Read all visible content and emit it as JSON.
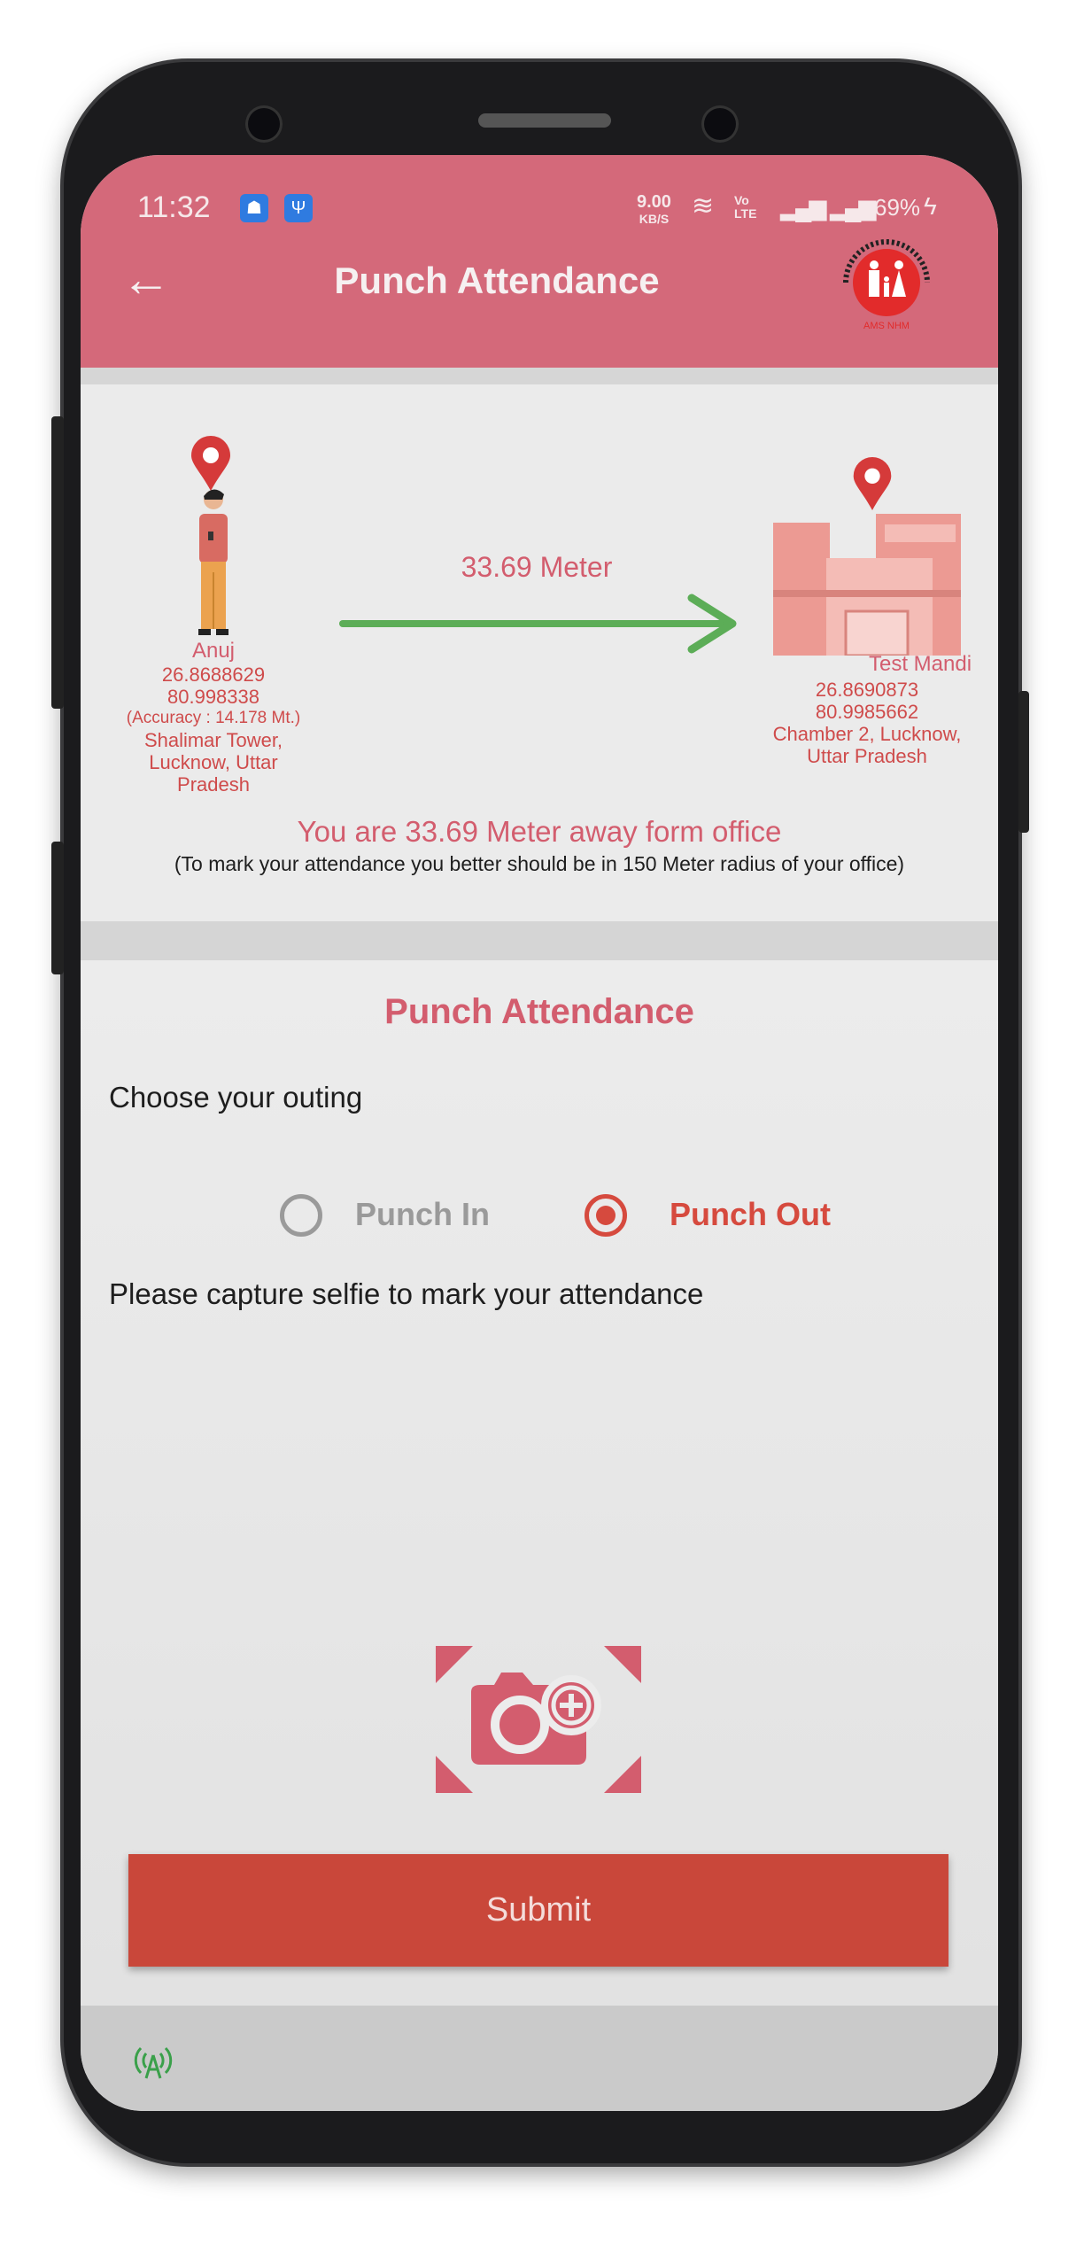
{
  "status_bar": {
    "time": "11:32",
    "net_speed": "9.00",
    "net_unit": "KB/S",
    "volte": "Vo LTE",
    "battery": "69%"
  },
  "header": {
    "title": "Punch Attendance",
    "logo_text": "NATIONAL HEALTH MISSION",
    "logo_sub": "राष्ट्रीय स्वास्थ्य मिशन",
    "logo_caption": "AMS NHM"
  },
  "location": {
    "user": {
      "name": "Anuj",
      "lat": "26.8688629",
      "lng": "80.998338",
      "accuracy": "(Accuracy : 14.178 Mt.)",
      "address": "Shalimar Tower, Lucknow, Uttar Pradesh"
    },
    "distance": "33.69 Meter",
    "office": {
      "name": "Test Mandi",
      "lat": "26.8690873",
      "lng": "80.9985662",
      "address": "Chamber 2, Lucknow, Uttar Pradesh"
    },
    "message": "You are 33.69 Meter away form office",
    "note": "(To mark your attendance you better should be in 150 Meter radius of your office)"
  },
  "form": {
    "heading": "Punch Attendance",
    "outing_label": "Choose your outing",
    "options": [
      {
        "label": "Punch In",
        "selected": false
      },
      {
        "label": "Punch Out",
        "selected": true
      }
    ],
    "selfie_label": "Please capture selfie to mark your attendance",
    "submit": "Submit"
  },
  "colors": {
    "header": "#d4697a",
    "accent": "#cf4b4b",
    "submit": "#c9473a",
    "arrow": "#5cad57"
  }
}
